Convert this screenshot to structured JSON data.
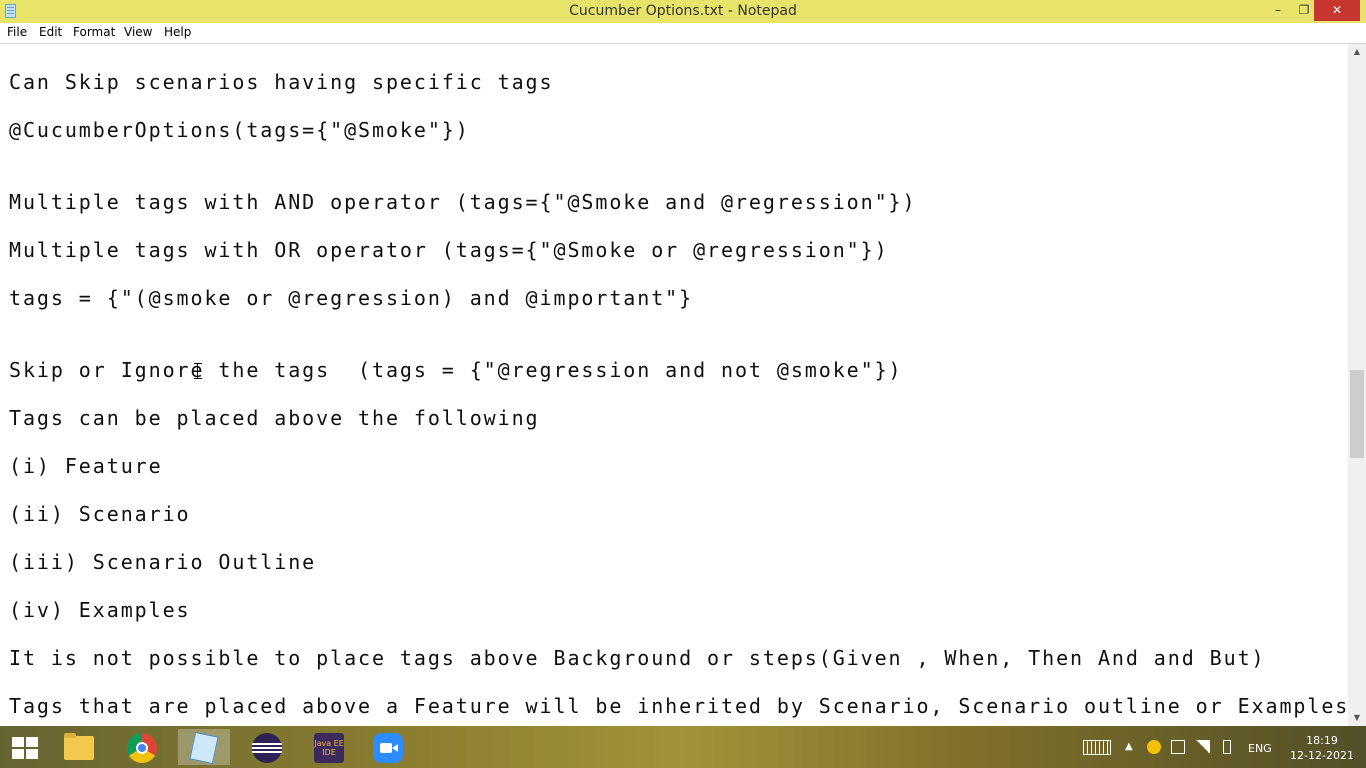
{
  "window": {
    "title": "Cucumber Options.txt - Notepad",
    "min": "–",
    "max": "❐",
    "close": "✕"
  },
  "menu": {
    "file": "File",
    "edit": "Edit",
    "format": "Format",
    "view": "View",
    "help": "Help"
  },
  "content": {
    "lines": [
      "Can Skip scenarios having specific tags",
      "@CucumberOptions(tags={\"@Smoke\"})",
      "Multiple tags with AND operator (tags={\"@Smoke and @regression\"})",
      "Multiple tags with OR operator (tags={\"@Smoke or @regression\"})",
      "tags = {\"(@smoke or @regression) and @important\"}",
      "Skip or Ignore the tags  (tags = {\"@regression and not @smoke\"})",
      "Tags can be placed above the following",
      "(i) Feature",
      "(ii) Scenario",
      "(iii) Scenario Outline",
      "(iv) Examples",
      "It is not possible to place tags above Background or steps(Given , When, Then And and But)",
      "Tags that are placed above a Feature will be inherited by Scenario, Scenario outline or Examples"
    ]
  },
  "scrollbar": {
    "up": "▲",
    "down": "▼"
  },
  "taskbar": {
    "javaee_label": "Java EE IDE",
    "lang": "ENG",
    "time": "18:19",
    "date": "12-12-2021",
    "chevron": "▲"
  }
}
